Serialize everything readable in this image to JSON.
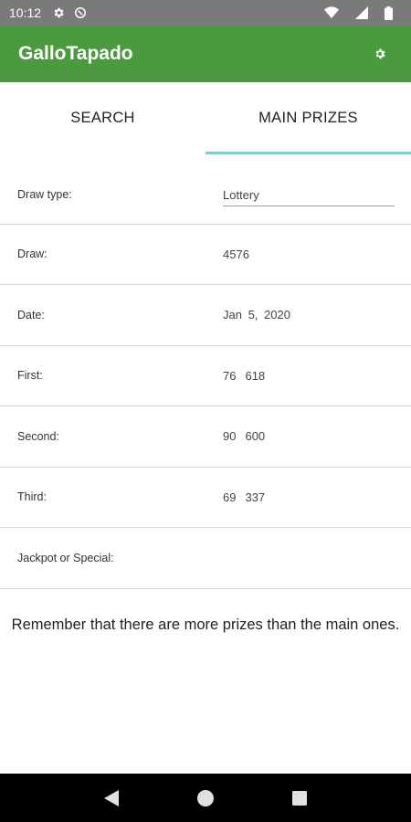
{
  "status_bar": {
    "time": "10:12"
  },
  "app_bar": {
    "title": "GalloTapado"
  },
  "tabs": [
    {
      "label": "SEARCH",
      "active": false
    },
    {
      "label": "MAIN PRIZES",
      "active": true
    }
  ],
  "form": {
    "draw_type": {
      "label": "Draw type:",
      "value": "Lottery"
    },
    "draw": {
      "label": "Draw:",
      "value": "4576"
    },
    "date": {
      "label": "Date:",
      "value": "Jan 5, 2020"
    },
    "first": {
      "label": "First:",
      "num1": "76",
      "num2": "618"
    },
    "second": {
      "label": "Second:",
      "num1": "90",
      "num2": "600"
    },
    "third": {
      "label": "Third:",
      "num1": "69",
      "num2": "337"
    },
    "jackpot": {
      "label": "Jackpot or Special:",
      "value": ""
    }
  },
  "note": "Remember that there are more prizes than the main ones.",
  "colors": {
    "app_bar": "#4c9a3f",
    "tab_indicator": "#7fcfc7",
    "status_bar": "#7a7a7a"
  }
}
